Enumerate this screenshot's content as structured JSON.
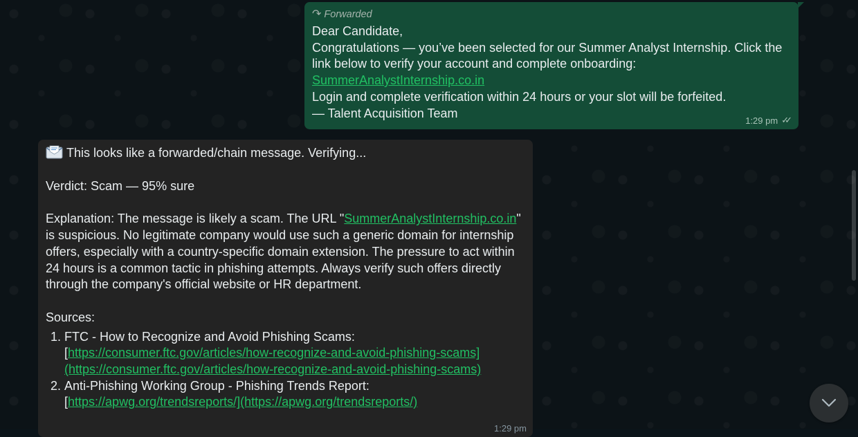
{
  "outgoing_message": {
    "forwarded_label": "Forwarded",
    "lines": [
      "Dear Candidate,",
      "Congratulations — you’ve been selected for our Summer Analyst Internship. Click the link below to verify your account and complete onboarding:"
    ],
    "link_text": "SummerAnalystInternship.co.in",
    "lines_after": [
      "Login and complete verification within 24 hours or your slot will be forfeited.",
      "— Talent Acquisition Team"
    ],
    "time": "1:29 pm",
    "status_icon": "double-check-icon"
  },
  "incoming_message": {
    "intro": "This looks like a forwarded/chain message. Verifying...",
    "intro_icon": "envelope-icon",
    "verdict": "Verdict: Scam — 95% sure",
    "explanation_prefix": "Explanation: The message is likely a scam. The URL \"",
    "explanation_link": "SummerAnalystInternship.co.in",
    "explanation_suffix": "\" is suspicious. No legitimate company would use such a generic domain for internship offers, especially with a country-specific domain extension. The pressure to act within 24 hours is a common tactic in phishing attempts. Always verify such offers directly through the company's official website or HR department.",
    "sources_label": "Sources:",
    "sources": [
      {
        "title": "FTC - How to Recognize and Avoid Phishing Scams:",
        "bracket_open": "[",
        "link_text": "https://consumer.ftc.gov/articles/how-recognize-and-avoid-phishing-scams](https://consumer.ftc.gov/articles/how-recognize-and-avoid-phishing-scams)"
      },
      {
        "title": "Anti-Phishing Working Group - Phishing Trends Report:",
        "bracket_open": "[",
        "link_text": "https://apwg.org/trendsreports/](https://apwg.org/trendsreports/)"
      }
    ],
    "time": "1:29 pm"
  },
  "controls": {
    "scroll_down_icon": "chevron-down-icon"
  },
  "colors": {
    "outgoing_bubble": "#144d37",
    "incoming_bubble": "#232323",
    "link": "#21c063",
    "background": "#0c1317"
  }
}
